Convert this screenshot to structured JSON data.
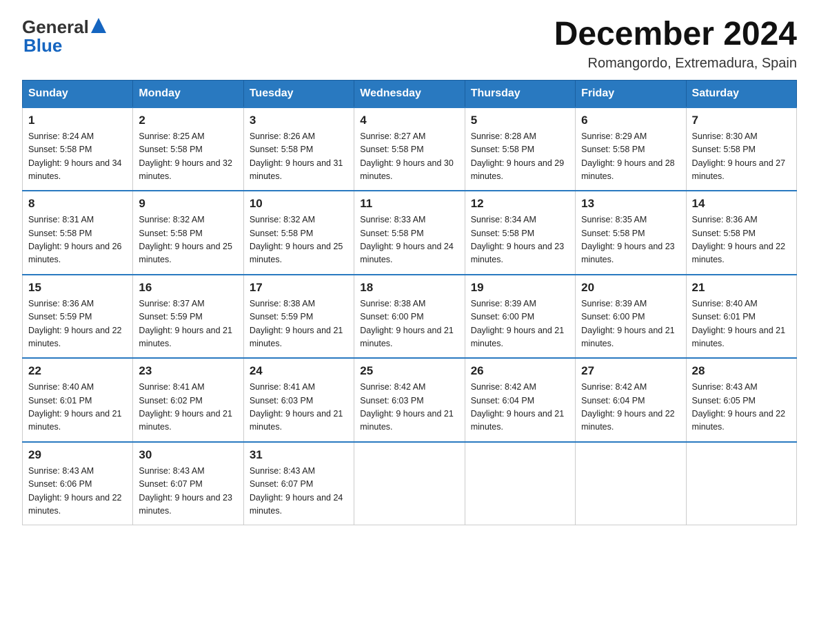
{
  "header": {
    "logo_text1": "General",
    "logo_text2": "Blue",
    "month_year": "December 2024",
    "location": "Romangordo, Extremadura, Spain"
  },
  "days_of_week": [
    "Sunday",
    "Monday",
    "Tuesday",
    "Wednesday",
    "Thursday",
    "Friday",
    "Saturday"
  ],
  "weeks": [
    [
      {
        "day": "1",
        "sunrise": "8:24 AM",
        "sunset": "5:58 PM",
        "daylight": "9 hours and 34 minutes."
      },
      {
        "day": "2",
        "sunrise": "8:25 AM",
        "sunset": "5:58 PM",
        "daylight": "9 hours and 32 minutes."
      },
      {
        "day": "3",
        "sunrise": "8:26 AM",
        "sunset": "5:58 PM",
        "daylight": "9 hours and 31 minutes."
      },
      {
        "day": "4",
        "sunrise": "8:27 AM",
        "sunset": "5:58 PM",
        "daylight": "9 hours and 30 minutes."
      },
      {
        "day": "5",
        "sunrise": "8:28 AM",
        "sunset": "5:58 PM",
        "daylight": "9 hours and 29 minutes."
      },
      {
        "day": "6",
        "sunrise": "8:29 AM",
        "sunset": "5:58 PM",
        "daylight": "9 hours and 28 minutes."
      },
      {
        "day": "7",
        "sunrise": "8:30 AM",
        "sunset": "5:58 PM",
        "daylight": "9 hours and 27 minutes."
      }
    ],
    [
      {
        "day": "8",
        "sunrise": "8:31 AM",
        "sunset": "5:58 PM",
        "daylight": "9 hours and 26 minutes."
      },
      {
        "day": "9",
        "sunrise": "8:32 AM",
        "sunset": "5:58 PM",
        "daylight": "9 hours and 25 minutes."
      },
      {
        "day": "10",
        "sunrise": "8:32 AM",
        "sunset": "5:58 PM",
        "daylight": "9 hours and 25 minutes."
      },
      {
        "day": "11",
        "sunrise": "8:33 AM",
        "sunset": "5:58 PM",
        "daylight": "9 hours and 24 minutes."
      },
      {
        "day": "12",
        "sunrise": "8:34 AM",
        "sunset": "5:58 PM",
        "daylight": "9 hours and 23 minutes."
      },
      {
        "day": "13",
        "sunrise": "8:35 AM",
        "sunset": "5:58 PM",
        "daylight": "9 hours and 23 minutes."
      },
      {
        "day": "14",
        "sunrise": "8:36 AM",
        "sunset": "5:58 PM",
        "daylight": "9 hours and 22 minutes."
      }
    ],
    [
      {
        "day": "15",
        "sunrise": "8:36 AM",
        "sunset": "5:59 PM",
        "daylight": "9 hours and 22 minutes."
      },
      {
        "day": "16",
        "sunrise": "8:37 AM",
        "sunset": "5:59 PM",
        "daylight": "9 hours and 21 minutes."
      },
      {
        "day": "17",
        "sunrise": "8:38 AM",
        "sunset": "5:59 PM",
        "daylight": "9 hours and 21 minutes."
      },
      {
        "day": "18",
        "sunrise": "8:38 AM",
        "sunset": "6:00 PM",
        "daylight": "9 hours and 21 minutes."
      },
      {
        "day": "19",
        "sunrise": "8:39 AM",
        "sunset": "6:00 PM",
        "daylight": "9 hours and 21 minutes."
      },
      {
        "day": "20",
        "sunrise": "8:39 AM",
        "sunset": "6:00 PM",
        "daylight": "9 hours and 21 minutes."
      },
      {
        "day": "21",
        "sunrise": "8:40 AM",
        "sunset": "6:01 PM",
        "daylight": "9 hours and 21 minutes."
      }
    ],
    [
      {
        "day": "22",
        "sunrise": "8:40 AM",
        "sunset": "6:01 PM",
        "daylight": "9 hours and 21 minutes."
      },
      {
        "day": "23",
        "sunrise": "8:41 AM",
        "sunset": "6:02 PM",
        "daylight": "9 hours and 21 minutes."
      },
      {
        "day": "24",
        "sunrise": "8:41 AM",
        "sunset": "6:03 PM",
        "daylight": "9 hours and 21 minutes."
      },
      {
        "day": "25",
        "sunrise": "8:42 AM",
        "sunset": "6:03 PM",
        "daylight": "9 hours and 21 minutes."
      },
      {
        "day": "26",
        "sunrise": "8:42 AM",
        "sunset": "6:04 PM",
        "daylight": "9 hours and 21 minutes."
      },
      {
        "day": "27",
        "sunrise": "8:42 AM",
        "sunset": "6:04 PM",
        "daylight": "9 hours and 22 minutes."
      },
      {
        "day": "28",
        "sunrise": "8:43 AM",
        "sunset": "6:05 PM",
        "daylight": "9 hours and 22 minutes."
      }
    ],
    [
      {
        "day": "29",
        "sunrise": "8:43 AM",
        "sunset": "6:06 PM",
        "daylight": "9 hours and 22 minutes."
      },
      {
        "day": "30",
        "sunrise": "8:43 AM",
        "sunset": "6:07 PM",
        "daylight": "9 hours and 23 minutes."
      },
      {
        "day": "31",
        "sunrise": "8:43 AM",
        "sunset": "6:07 PM",
        "daylight": "9 hours and 24 minutes."
      },
      null,
      null,
      null,
      null
    ]
  ],
  "labels": {
    "sunrise_prefix": "Sunrise: ",
    "sunset_prefix": "Sunset: ",
    "daylight_prefix": "Daylight: "
  }
}
